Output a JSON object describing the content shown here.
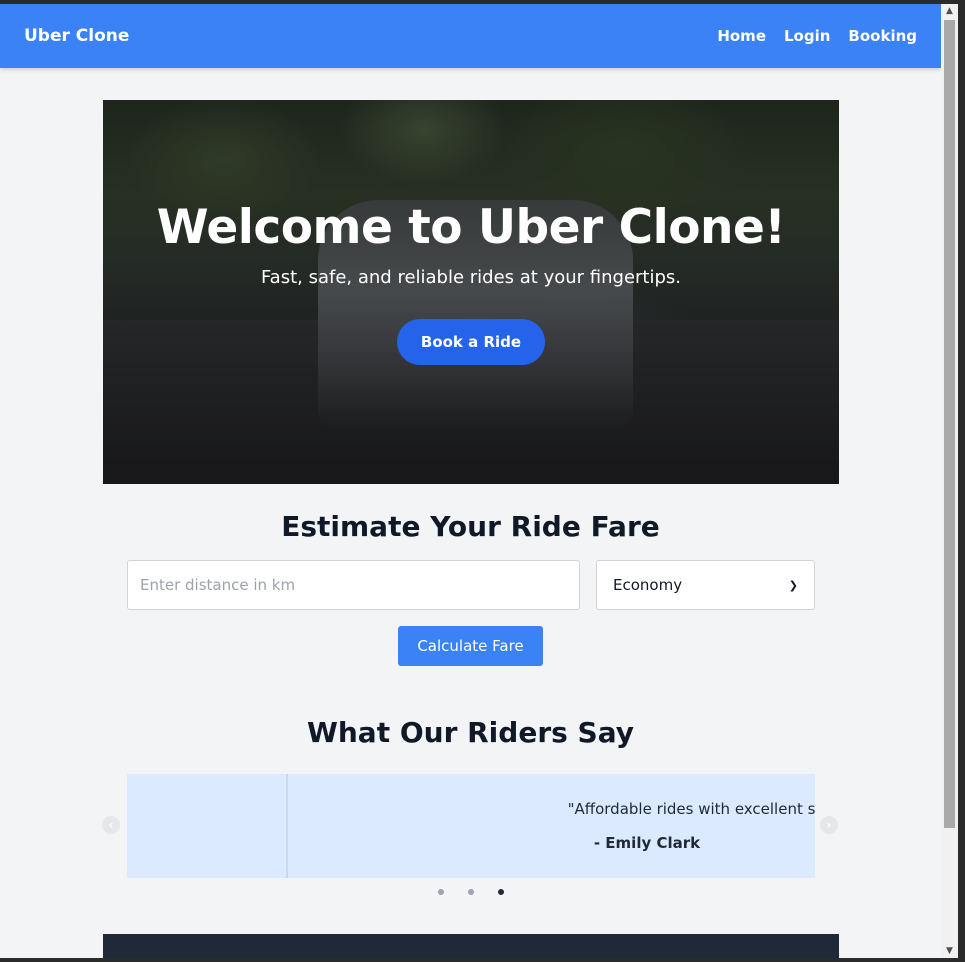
{
  "navbar": {
    "brand": "Uber Clone",
    "links": [
      "Home",
      "Login",
      "Booking"
    ]
  },
  "hero": {
    "title": "Welcome to Uber Clone!",
    "subtitle": "Fast, safe, and reliable rides at your fingertips.",
    "button_label": "Book a Ride"
  },
  "fare": {
    "title": "Estimate Your Ride Fare",
    "distance_placeholder": "Enter distance in km",
    "ride_type_selected": "Economy",
    "button_label": "Calculate Fare"
  },
  "testimonials": {
    "title": "What Our Riders Say",
    "quote": "\"Affordable rides with excellent service.\"",
    "author": "- Emily Clark",
    "slide_count": 3,
    "active_slide": 3
  },
  "colors": {
    "primary": "#3b82f6",
    "hero_button": "#2563eb",
    "background": "#f3f4f6",
    "testimonial_bg": "#dbeafe",
    "footer": "#1f2937",
    "text_dark": "#111827"
  },
  "icons": [
    "chevron-left-icon",
    "chevron-right-icon",
    "chevron-down-icon",
    "scroll-up-icon",
    "scroll-down-icon"
  ]
}
